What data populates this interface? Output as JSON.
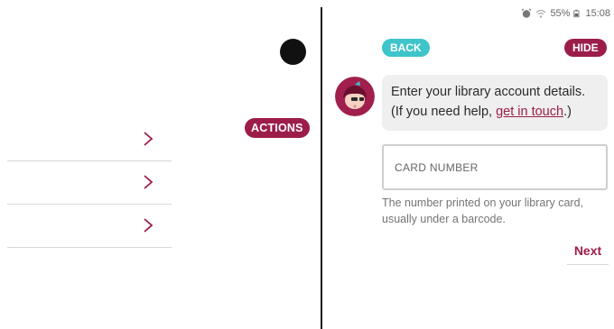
{
  "left_pane": {
    "actions_label": "ACTIONS",
    "rows": [
      {
        "icon": "chevron-right-icon"
      },
      {
        "icon": "chevron-right-icon"
      },
      {
        "icon": "chevron-right-icon"
      }
    ]
  },
  "status_bar": {
    "battery": "55%",
    "time": "15:08"
  },
  "signup": {
    "back_label": "BACK",
    "hide_label": "HIDE",
    "message_text": "Enter your library account details. (If you need help, ",
    "message_link": "get in touch",
    "message_end": ".)",
    "card_placeholder": "CARD NUMBER",
    "help_text": "The number printed on your library card, usually under a barcode.",
    "next_label": "Next"
  },
  "colors": {
    "brand": "#9c1d4a",
    "accent": "#3ec4c9"
  }
}
